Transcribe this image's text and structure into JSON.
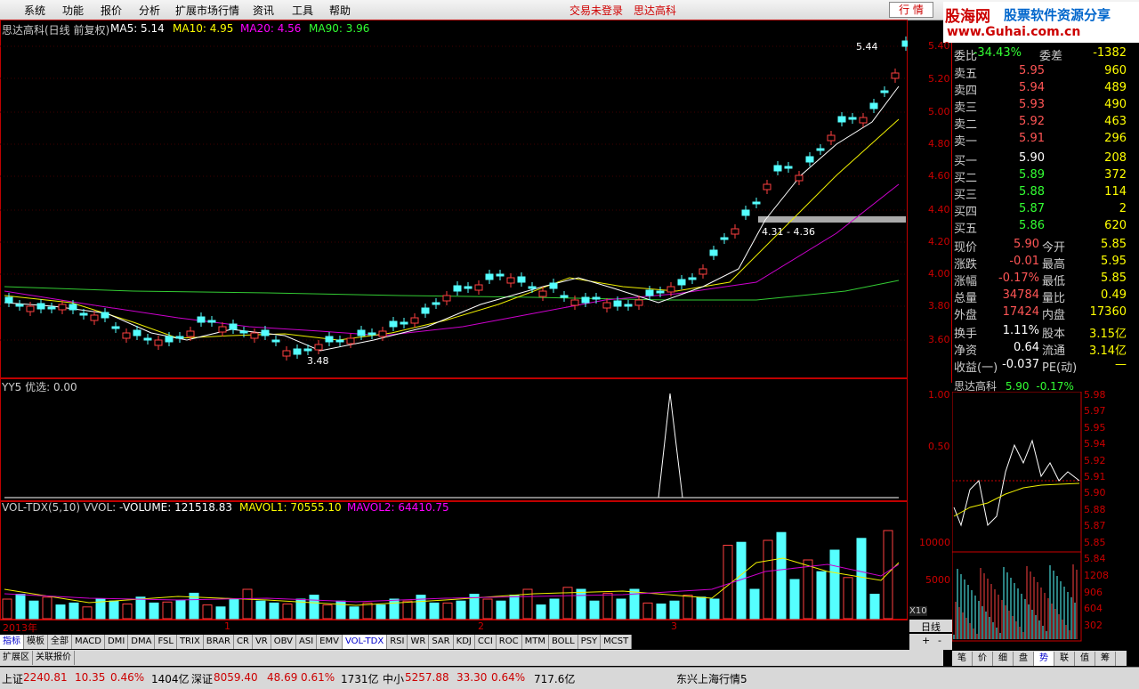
{
  "menu": [
    "系统",
    "功能",
    "报价",
    "分析",
    "扩展市场行情",
    "资讯",
    "工具",
    "帮助"
  ],
  "menu_status": {
    "login": "交易未登录",
    "stock": "思达高科"
  },
  "tab_button": "行 情",
  "brand": {
    "name": "股海网",
    "slogan": "股票软件资源分享",
    "url": "www.Guhai.com.cn"
  },
  "kline": {
    "title": "思达高科(日线 前复权)",
    "ma5": "MA5: 5.14",
    "ma10": "MA10: 4.95",
    "ma20": "MA20: 4.56",
    "ma90": "MA90: 3.96",
    "high_label": "5.44",
    "low_label": "3.48",
    "zone_label": "4.31 - 4.36",
    "y_ticks": [
      "5.40",
      "5.20",
      "5.00",
      "4.80",
      "4.60",
      "4.40",
      "4.20",
      "4.00",
      "3.80",
      "3.60"
    ],
    "x_labels": [
      "2013年",
      "1",
      "2",
      "3"
    ]
  },
  "yy5": {
    "title": "YY5  优选: 0.00",
    "y_ticks": [
      "1.00",
      "0.50"
    ]
  },
  "vol": {
    "title": "VOL-TDX(5,10) VVOL: -",
    "volume": "VOLUME: 121518.83",
    "mavol1": "MAVOL1: 70555.10",
    "mavol2": "MAVOL2: 64410.75",
    "y_ticks": [
      "10000",
      "5000"
    ],
    "unit": "X10"
  },
  "quote": {
    "weibi_lbl": "委比",
    "weibi": "-34.43%",
    "weicha_lbl": "委差",
    "weicha": "-1382",
    "asks": [
      {
        "l": "卖五",
        "p": "5.95",
        "v": "960"
      },
      {
        "l": "卖四",
        "p": "5.94",
        "v": "489"
      },
      {
        "l": "卖三",
        "p": "5.93",
        "v": "490"
      },
      {
        "l": "卖二",
        "p": "5.92",
        "v": "463"
      },
      {
        "l": "卖一",
        "p": "5.91",
        "v": "296"
      }
    ],
    "bids": [
      {
        "l": "买一",
        "p": "5.90",
        "v": "208"
      },
      {
        "l": "买二",
        "p": "5.89",
        "v": "372"
      },
      {
        "l": "买三",
        "p": "5.88",
        "v": "114"
      },
      {
        "l": "买四",
        "p": "5.87",
        "v": "2"
      },
      {
        "l": "买五",
        "p": "5.86",
        "v": "620"
      }
    ],
    "stats": [
      {
        "l1": "现价",
        "v1": "5.90",
        "l2": "今开",
        "v2": "5.85"
      },
      {
        "l1": "涨跌",
        "v1": "-0.01",
        "l2": "最高",
        "v2": "5.95"
      },
      {
        "l1": "涨幅",
        "v1": "-0.17%",
        "l2": "最低",
        "v2": "5.85"
      },
      {
        "l1": "总量",
        "v1": "34784",
        "l2": "量比",
        "v2": "0.49"
      },
      {
        "l1": "外盘",
        "v1": "17424",
        "l2": "内盘",
        "v2": "17360"
      }
    ],
    "fin": [
      {
        "l1": "换手",
        "v1": "1.11%",
        "l2": "股本",
        "v2": "3.15亿"
      },
      {
        "l1": "净资",
        "v1": "0.64",
        "l2": "流通",
        "v2": "3.14亿"
      },
      {
        "l1": "收益(一)",
        "v1": "-0.037",
        "l2": "PE(动)",
        "v2": "—"
      }
    ]
  },
  "mini": {
    "title": "思达高科",
    "price": "5.90",
    "change": "-0.17%",
    "y_ticks": [
      "5.98",
      "5.97",
      "5.95",
      "5.94",
      "5.92",
      "5.91",
      "5.90",
      "5.88",
      "5.87",
      "5.85",
      "5.84"
    ],
    "vol_ticks": [
      "1208",
      "906",
      "604",
      "302"
    ]
  },
  "indicator_tabs": [
    "指标",
    "模板",
    "全部",
    "MACD",
    "DMI",
    "DMA",
    "FSL",
    "TRIX",
    "BRAR",
    "CR",
    "VR",
    "OBV",
    "ASI",
    "EMV",
    "VOL-TDX",
    "RSI",
    "WR",
    "SAR",
    "KDJ",
    "CCI",
    "ROC",
    "MTM",
    "BOLL",
    "PSY",
    "MCST"
  ],
  "bottom_tabs": [
    "扩展区",
    "关联报价"
  ],
  "period": "日线",
  "mini_tabs": [
    "笔",
    "价",
    "细",
    "盘",
    "势",
    "联",
    "值",
    "筹"
  ],
  "status": {
    "sh_lbl": "上证",
    "sh": "2240.81",
    "sh_chg": "10.35",
    "sh_pct": "0.46%",
    "sh_amt": "1404亿",
    "sz_lbl": "深证",
    "sz": "8059.40",
    "sz_chg": "48.69",
    "sz_pct": "0.61%",
    "sz_amt": "1731亿",
    "zx_lbl": "中小",
    "zx": "5257.88",
    "zx_chg": "33.30",
    "zx_pct": "0.64%",
    "zx_amt": "717.6亿",
    "server": "东兴上海行情5"
  }
}
